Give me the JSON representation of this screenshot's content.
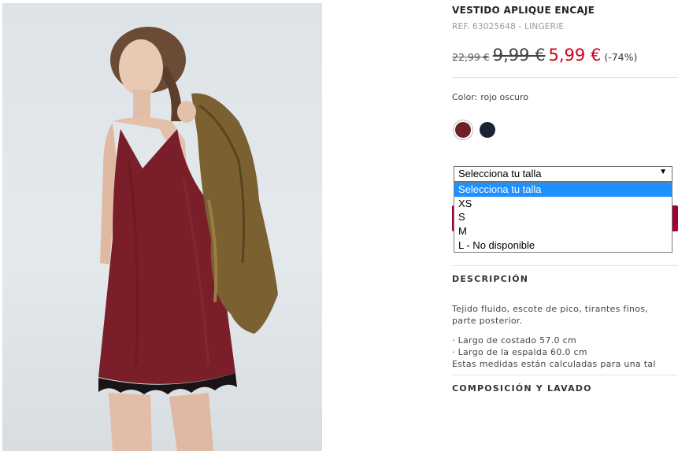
{
  "product": {
    "title": "VESTIDO APLIQUE ENCAJE",
    "ref": "REF. 63025648 - LINGERIE",
    "price_original": "22,99 €",
    "price_intermediate": "9,99 €",
    "price_sale": "5,99 €",
    "discount": "(-74%)",
    "image_alt": "Modelo con vestido lencero rojo oscuro con encaje negro y chaqueta bomber satinada"
  },
  "color": {
    "label": "Color:",
    "value": "rojo oscuro",
    "swatches": [
      {
        "name": "rojo oscuro",
        "hex": "#6e1f27"
      },
      {
        "name": "marino",
        "hex": "#1b2230"
      }
    ]
  },
  "size": {
    "selected": "Selecciona tu talla",
    "options": [
      "Selecciona tu talla",
      "XS",
      "S",
      "M",
      "L - No disponible"
    ],
    "highlighted_index": 0
  },
  "description": {
    "heading": "DESCRIPCIÓN",
    "text_line1": "Tejido fluido, escote de pico, tirantes finos,",
    "text_line2": "parte posterior.",
    "measure1": "· Largo de costado 57.0 cm",
    "measure2": "· Largo de la espalda 60.0 cm",
    "note": "Estas medidas están calculadas para una tal"
  },
  "composition": {
    "heading": "COMPOSICIÓN Y LAVADO"
  },
  "colors": {
    "sale": "#d0021b",
    "highlight": "#1e90ff",
    "button": "#a30033"
  }
}
